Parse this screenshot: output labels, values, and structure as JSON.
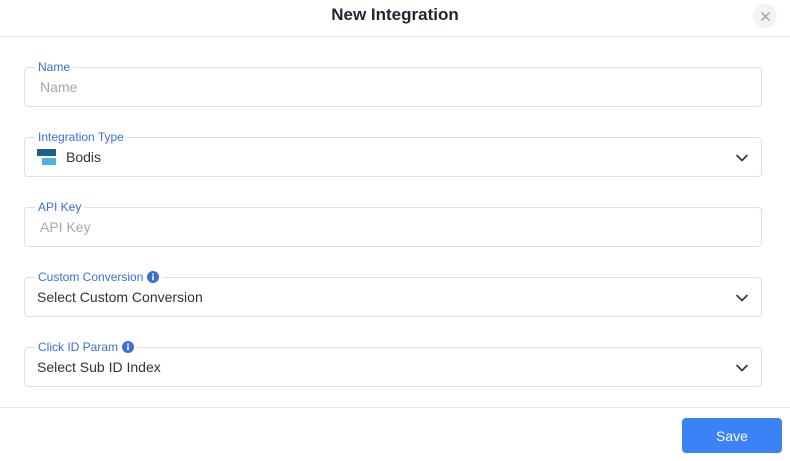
{
  "modal": {
    "title": "New Integration",
    "close_icon": "close-icon"
  },
  "fields": {
    "name": {
      "label": "Name",
      "placeholder": "Name",
      "value": ""
    },
    "integration_type": {
      "label": "Integration Type",
      "value": "Bodis",
      "icon": "bodis-logo-icon"
    },
    "api_key": {
      "label": "API Key",
      "placeholder": "API Key",
      "value": ""
    },
    "custom_conversion": {
      "label": "Custom Conversion",
      "value": "Select Custom Conversion",
      "info_icon": "info-icon"
    },
    "click_id_param": {
      "label": "Click ID Param",
      "value": "Select Sub ID Index",
      "info_icon": "info-icon"
    }
  },
  "footer": {
    "save_label": "Save"
  },
  "colors": {
    "accent": "#3b82f6",
    "label": "#3b6fd8",
    "border": "#dcdfe4",
    "logo_dark": "#1f5f8b",
    "logo_light": "#4fb3e8"
  }
}
